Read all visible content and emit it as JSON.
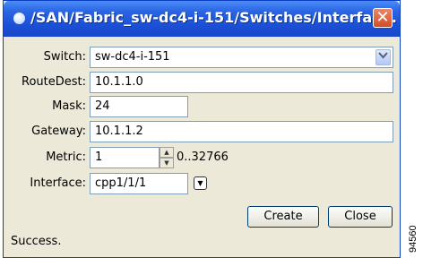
{
  "window": {
    "title": "/SAN/Fabric_sw-dc4-i-151/Switches/Interfac...",
    "close_glyph": "✕"
  },
  "form": {
    "switch": {
      "label": "Switch:",
      "value": "sw-dc4-i-151"
    },
    "routedest": {
      "label": "RouteDest:",
      "value": "10.1.1.0"
    },
    "mask": {
      "label": "Mask:",
      "value": "24"
    },
    "gateway": {
      "label": "Gateway:",
      "value": "10.1.1.2"
    },
    "metric": {
      "label": "Metric:",
      "value": "1",
      "range": "0..32766"
    },
    "interface": {
      "label": "Interface:",
      "value": "cpp1/1/1"
    }
  },
  "buttons": {
    "create": "Create",
    "close": "Close"
  },
  "status": "Success.",
  "figure_id": "94560",
  "icons": {
    "combo_arrow": "chevron-down-icon",
    "spin_up": "triangle-up-icon",
    "spin_down": "triangle-down-icon",
    "dropdown_toggle": "dropdown-icon"
  }
}
